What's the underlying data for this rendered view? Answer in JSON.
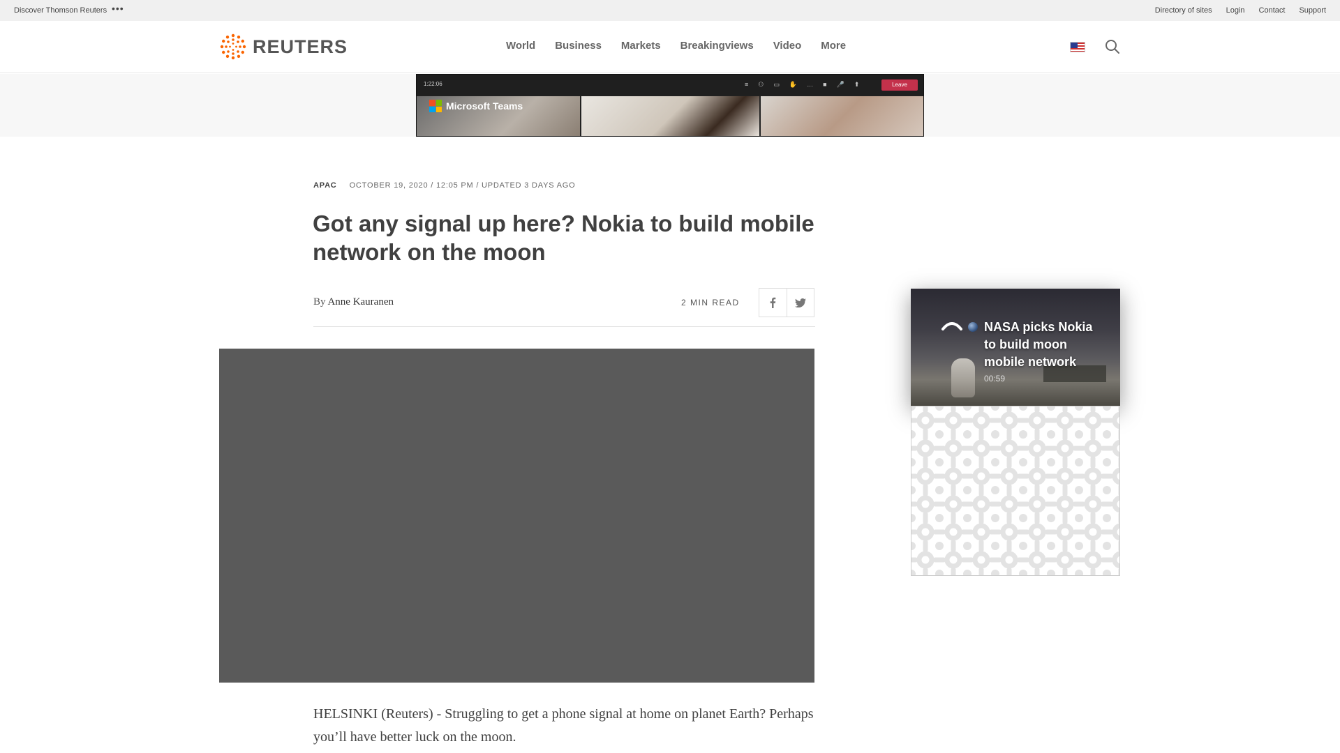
{
  "utility_bar": {
    "discover": "Discover Thomson Reuters",
    "more": "•••",
    "links": [
      "Directory of sites",
      "Login",
      "Contact",
      "Support"
    ]
  },
  "header": {
    "logo_text": "REUTERS",
    "nav": [
      "World",
      "Business",
      "Markets",
      "Breakingviews",
      "Video",
      "More"
    ],
    "region_icon": "us-flag-icon",
    "search_icon": "search-icon"
  },
  "ad": {
    "time": "1:22:06",
    "brand": "Microsoft Teams",
    "leave_label": "Leave",
    "controls": [
      "≡",
      "⚇",
      "▭",
      "✋",
      "…",
      "■",
      "🎤",
      "⬆"
    ]
  },
  "article": {
    "section": "APAC",
    "dateline": "OCTOBER 19, 2020 / 12:05 PM / UPDATED 3 DAYS AGO",
    "headline": "Got any signal up here? Nokia to build mobile network on the moon",
    "byline_prefix": "By",
    "author": "Anne Kauranen",
    "read_time": "2 MIN READ",
    "body_first": "HELSINKI (Reuters) - Struggling to get a phone signal at home on planet Earth? Perhaps you’ll have better luck on the moon."
  },
  "rail": {
    "video_title": "NASA picks Nokia to build moon mobile network",
    "video_duration": "00:59"
  },
  "colors": {
    "brand_orange": "#fa6400",
    "headline_text": "#404040",
    "video_placeholder": "#5a5a5a",
    "teams_leave_red": "#c4314b"
  }
}
